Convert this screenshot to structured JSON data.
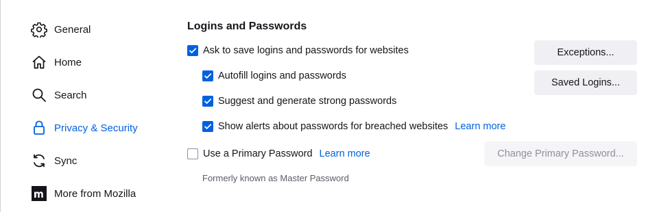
{
  "sidebar": {
    "items": [
      {
        "label": "General",
        "icon": "gear-icon"
      },
      {
        "label": "Home",
        "icon": "home-icon"
      },
      {
        "label": "Search",
        "icon": "search-icon"
      },
      {
        "label": "Privacy & Security",
        "icon": "lock-icon",
        "active": true
      },
      {
        "label": "Sync",
        "icon": "sync-icon"
      },
      {
        "label": "More from Mozilla",
        "icon": "mozilla-logo-icon"
      }
    ]
  },
  "logins": {
    "title": "Logins and Passwords",
    "ask_to_save": {
      "label": "Ask to save logins and passwords for websites",
      "checked": true
    },
    "autofill": {
      "label": "Autofill logins and passwords",
      "checked": true
    },
    "suggest_generate": {
      "label": "Suggest and generate strong passwords",
      "checked": true
    },
    "breach_alerts": {
      "label": "Show alerts about passwords for breached websites",
      "checked": true,
      "link": "Learn more"
    },
    "primary_password": {
      "label": "Use a Primary Password",
      "checked": false,
      "link": "Learn more"
    },
    "primary_password_hint": "Formerly known as Master Password",
    "buttons": {
      "exceptions": "Exceptions...",
      "saved_logins": "Saved Logins...",
      "change_primary_password": "Change Primary Password..."
    }
  },
  "colors": {
    "accent": "#0061e0",
    "text": "#15141a",
    "button_bg": "#f0f0f4",
    "disabled_text": "#8f8f9d"
  }
}
